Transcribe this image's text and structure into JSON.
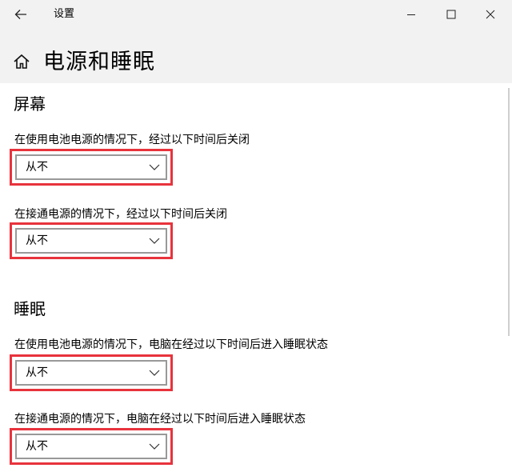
{
  "window": {
    "app_title": "设置",
    "page_title": "电源和睡眠"
  },
  "icons": {
    "back": "back-arrow-icon",
    "home": "home-icon",
    "minimize": "minimize-icon",
    "maximize": "maximize-icon",
    "close": "close-icon",
    "dropdown": "chevron-down-icon"
  },
  "colors": {
    "highlight_border": "#e8333d",
    "header_background": "#f2f2f2",
    "dropdown_border": "#999999"
  },
  "screen": {
    "heading": "屏幕",
    "battery_label": "在使用电池电源的情况下，经过以下时间后关闭",
    "battery_value": "从不",
    "plugged_label": "在接通电源的情况下，经过以下时间后关闭",
    "plugged_value": "从不"
  },
  "sleep": {
    "heading": "睡眠",
    "battery_label": "在使用电池电源的情况下，电脑在经过以下时间后进入睡眠状态",
    "battery_value": "从不",
    "plugged_label": "在接通电源的情况下，电脑在经过以下时间后进入睡眠状态",
    "plugged_value": "从不"
  }
}
